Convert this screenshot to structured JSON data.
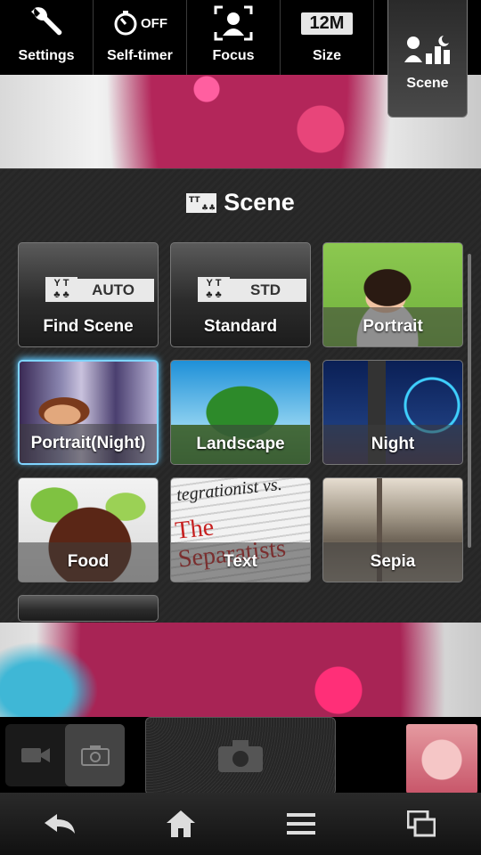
{
  "toolbar": {
    "settings_label": "Settings",
    "selftimer_label": "Self-timer",
    "selftimer_value": "OFF",
    "focus_label": "Focus",
    "size_label": "Size",
    "size_value": "12M",
    "scene_label": "Scene"
  },
  "panel": {
    "title": "Scene",
    "tiles": [
      {
        "label": "Find Scene",
        "badge": "AUTO"
      },
      {
        "label": "Standard",
        "badge": "STD"
      },
      {
        "label": "Portrait"
      },
      {
        "label": "Portrait(Night)"
      },
      {
        "label": "Landscape"
      },
      {
        "label": "Night"
      },
      {
        "label": "Food"
      },
      {
        "label": "Text"
      },
      {
        "label": "Sepia"
      }
    ],
    "text_tile_lines": [
      "tegrationist vs.",
      "The Separatists"
    ]
  },
  "icons": {
    "settings": "wrench-icon",
    "selftimer": "timer-icon",
    "focus": "face-focus-icon",
    "scene": "scene-icon",
    "video": "video-camera-icon",
    "photo": "camera-icon",
    "shutter": "shutter-camera-icon",
    "back": "back-icon",
    "home": "home-icon",
    "menu": "menu-icon",
    "recent": "recent-apps-icon"
  }
}
